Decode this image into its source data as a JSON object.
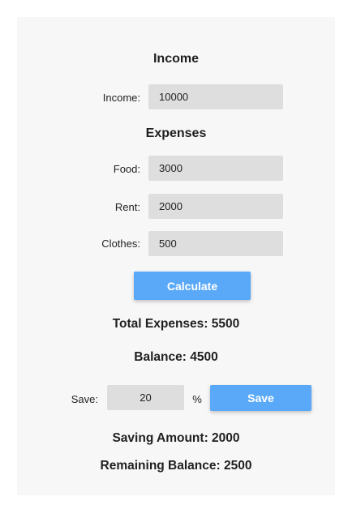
{
  "income_section": {
    "title": "Income",
    "income_label": "Income:",
    "income_value": "10000"
  },
  "expenses_section": {
    "title": "Expenses",
    "food_label": "Food:",
    "food_value": "3000",
    "rent_label": "Rent:",
    "rent_value": "2000",
    "clothes_label": "Clothes:",
    "clothes_value": "500"
  },
  "calculate_button": "Calculate",
  "results": {
    "total_expenses": "Total Expenses: 5500",
    "balance": "Balance: 4500"
  },
  "saving": {
    "label": "Save:",
    "percent_value": "20",
    "percent_symbol": "%",
    "save_button": "Save",
    "saving_amount": "Saving Amount: 2000",
    "remaining_balance": "Remaining Balance: 2500"
  },
  "colors": {
    "accent": "#5aa9f8",
    "card_background": "#f7f7f7",
    "input_background": "#dedede"
  }
}
